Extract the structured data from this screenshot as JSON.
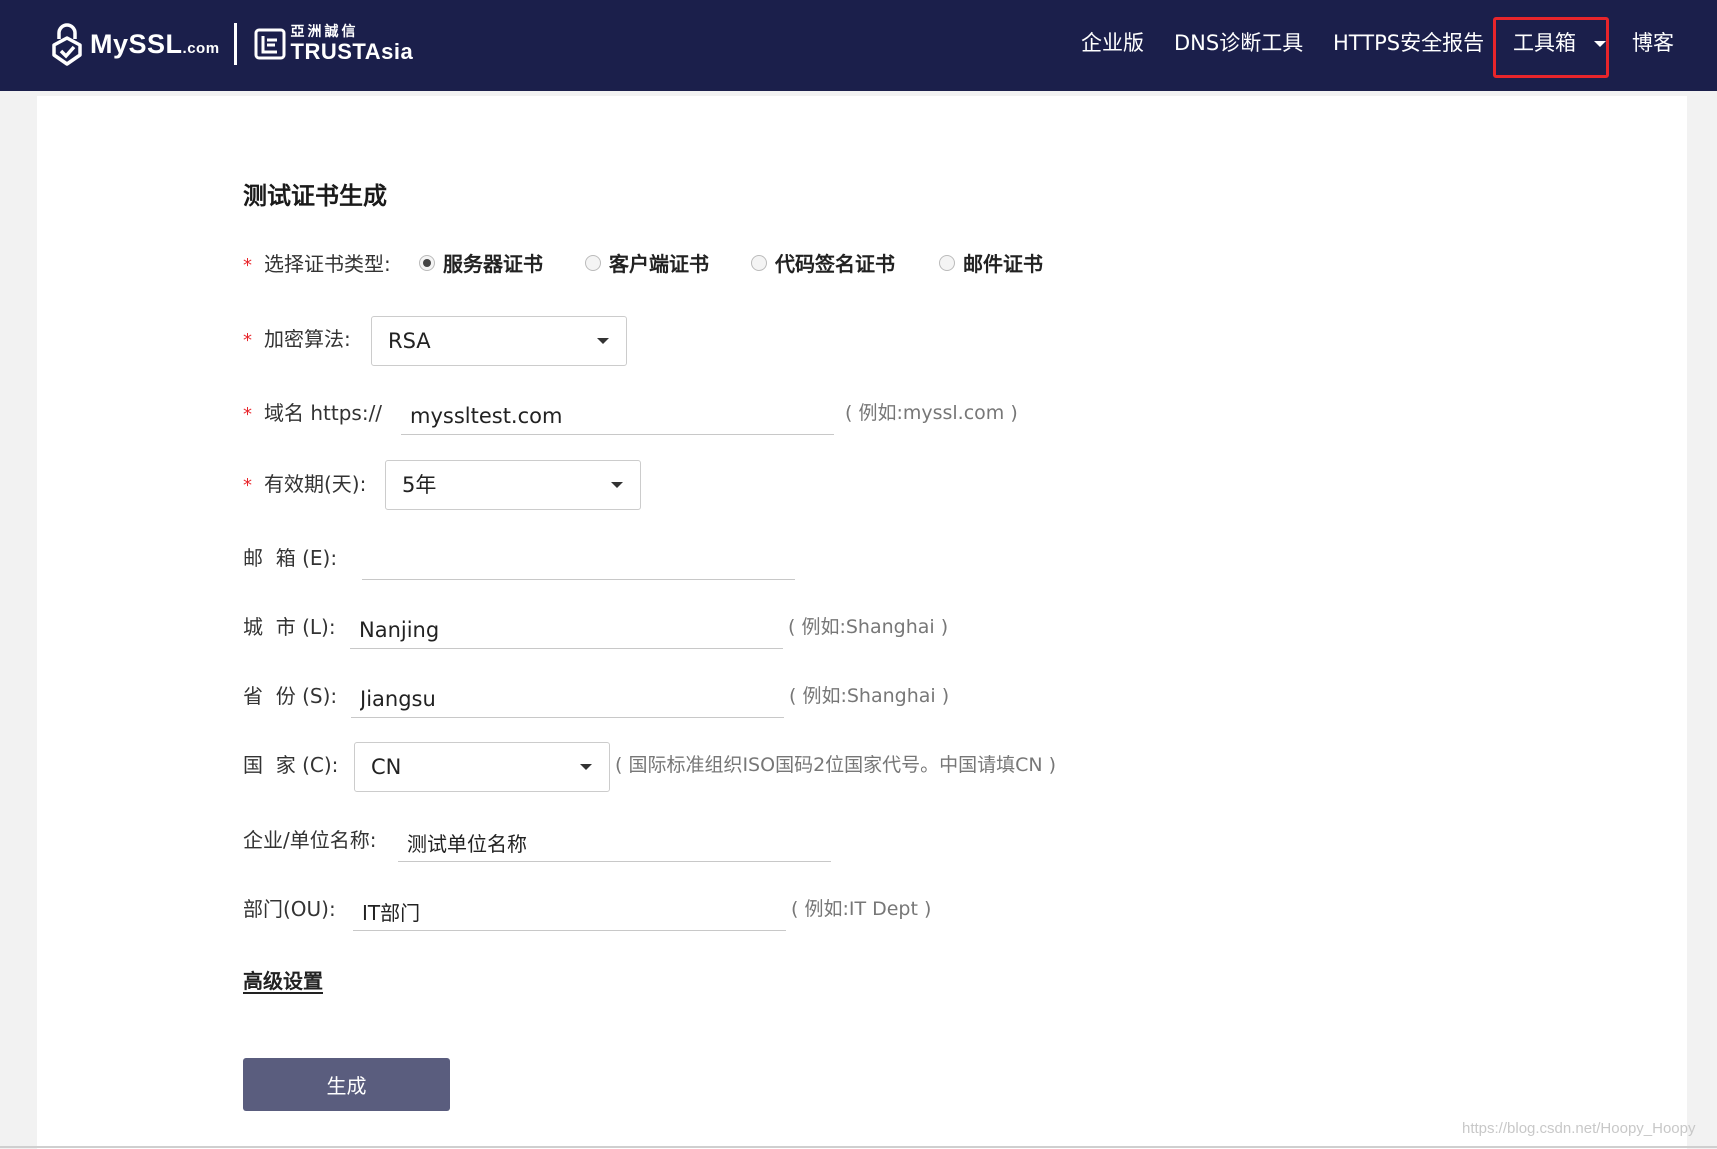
{
  "header": {
    "logo_text": "MySSL",
    "logo_suffix": ".com",
    "partner_cn": "亞洲誠信",
    "partner_en": "TRUSTAsia",
    "nav": {
      "enterprise": "企业版",
      "dns": "DNS诊断工具",
      "https": "HTTPS安全报告",
      "tools": "工具箱",
      "blog": "博客"
    },
    "highlight_color": "#e8252b",
    "bg_color": "#1b1f4b"
  },
  "form": {
    "title": "测试证书生成",
    "required_mark": "*",
    "cert_type": {
      "label": "选择证书类型:",
      "options": [
        "服务器证书",
        "客户端证书",
        "代码签名证书",
        "邮件证书"
      ],
      "selected": "服务器证书"
    },
    "algorithm": {
      "label": "加密算法:",
      "value": "RSA"
    },
    "domain": {
      "label": "域名 https://",
      "value": "myssltest.com",
      "hint": "( 例如:myssl.com )"
    },
    "validity": {
      "label": "有效期(天):",
      "value": "5年"
    },
    "email": {
      "label": "邮  箱 (E):",
      "value": ""
    },
    "city": {
      "label": "城  市 (L):",
      "value": "Nanjing",
      "hint": "( 例如:Shanghai )"
    },
    "province": {
      "label": "省  份 (S):",
      "value": "Jiangsu",
      "hint": "( 例如:Shanghai )"
    },
    "country": {
      "label": "国  家 (C):",
      "value": "CN",
      "hint": "( 国际标准组织ISO国码2位国家代号。中国请填CN )"
    },
    "organization": {
      "label": "企业/单位名称:",
      "value": "测试单位名称"
    },
    "department": {
      "label": "部门(OU):",
      "value": "IT部门",
      "hint": "( 例如:IT Dept )"
    },
    "advanced_link": "高级设置",
    "submit_label": "生成",
    "submit_color": "#5a5d7e"
  },
  "watermark": "https://blog.csdn.net/Hoopy_Hoopy"
}
